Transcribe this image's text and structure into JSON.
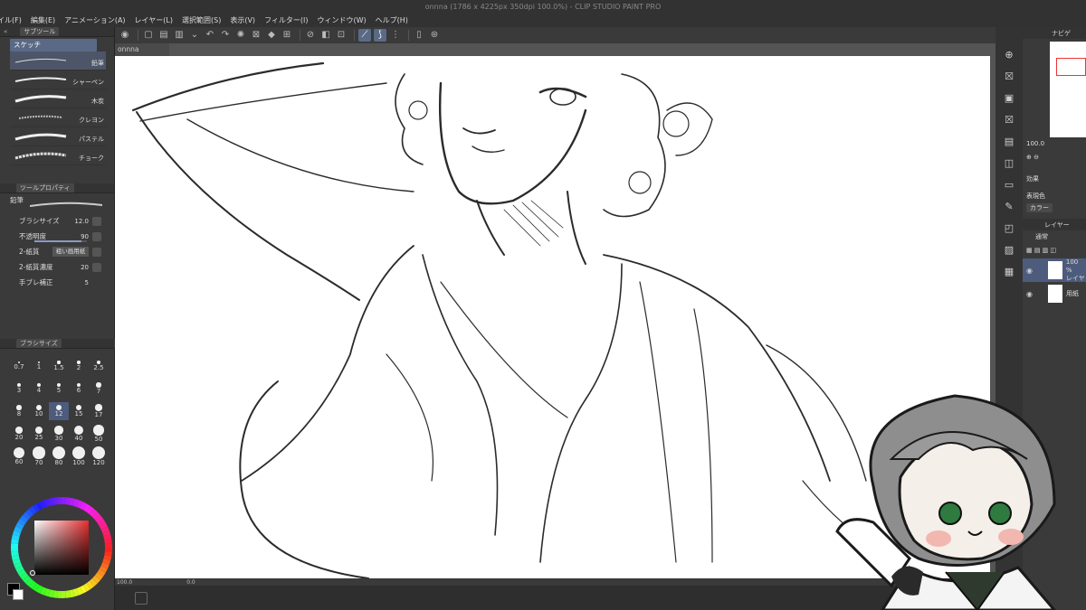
{
  "window": {
    "title": "onnna (1786 x 4225px 350dpi 100.0%) - CLIP STUDIO PAINT PRO"
  },
  "menu": [
    "イル(F)",
    "編集(E)",
    "アニメーション(A)",
    "レイヤー(L)",
    "選択範囲(S)",
    "表示(V)",
    "フィルター(I)",
    "ウィンドウ(W)",
    "ヘルプ(H)"
  ],
  "subtool_panel": {
    "header": "サブツール",
    "group": "スケッチ",
    "brushes": [
      {
        "name": "鉛筆",
        "selected": true
      },
      {
        "name": "シャーペン",
        "selected": false
      },
      {
        "name": "木炭",
        "selected": false
      },
      {
        "name": "クレヨン",
        "selected": false
      },
      {
        "name": "パステル",
        "selected": false
      },
      {
        "name": "チョーク",
        "selected": false
      }
    ]
  },
  "tool_property": {
    "header": "ツールプロパティ",
    "tool_name": "鉛筆",
    "brush_size_label": "ブラシサイズ",
    "brush_size_value": "12.0",
    "opacity_label": "不透明度",
    "opacity_value": "90",
    "opacity_fraction": 0.9,
    "paper_label": "2-紙質",
    "paper_value": "粗い画用紙",
    "paper_density_label": "2-紙質濃度",
    "paper_density_value": "20",
    "stabilizer_label": "手ブレ補正",
    "stabilizer_value": "5"
  },
  "brush_size_panel": {
    "header": "ブラシサイズ",
    "sizes": [
      "0.7",
      "1",
      "1.5",
      "2",
      "2.5",
      "3",
      "4",
      "5",
      "6",
      "7",
      "8",
      "10",
      "12",
      "15",
      "17",
      "20",
      "25",
      "30",
      "40",
      "50",
      "60",
      "70",
      "80",
      "100",
      "120"
    ],
    "selected": "12"
  },
  "canvas": {
    "doc_tab": "onnna",
    "zoom": "100.0",
    "angle": "0.0"
  },
  "navigator": {
    "header": "ナビゲ",
    "zoom": "100.0"
  },
  "effects": {
    "label": "効果",
    "expression_label": "表現色",
    "expression_value": "カラー"
  },
  "layer_panel": {
    "header": "レイヤー",
    "blend_mode": "通常",
    "layers": [
      {
        "name": "レイヤ",
        "opacity": "100 %",
        "selected": true
      },
      {
        "name": "用紙",
        "selected": false
      }
    ]
  },
  "colors": {
    "accent": "#5a6a86",
    "canvas_bg": "#545454",
    "panel_bg": "#3a3a3a"
  }
}
